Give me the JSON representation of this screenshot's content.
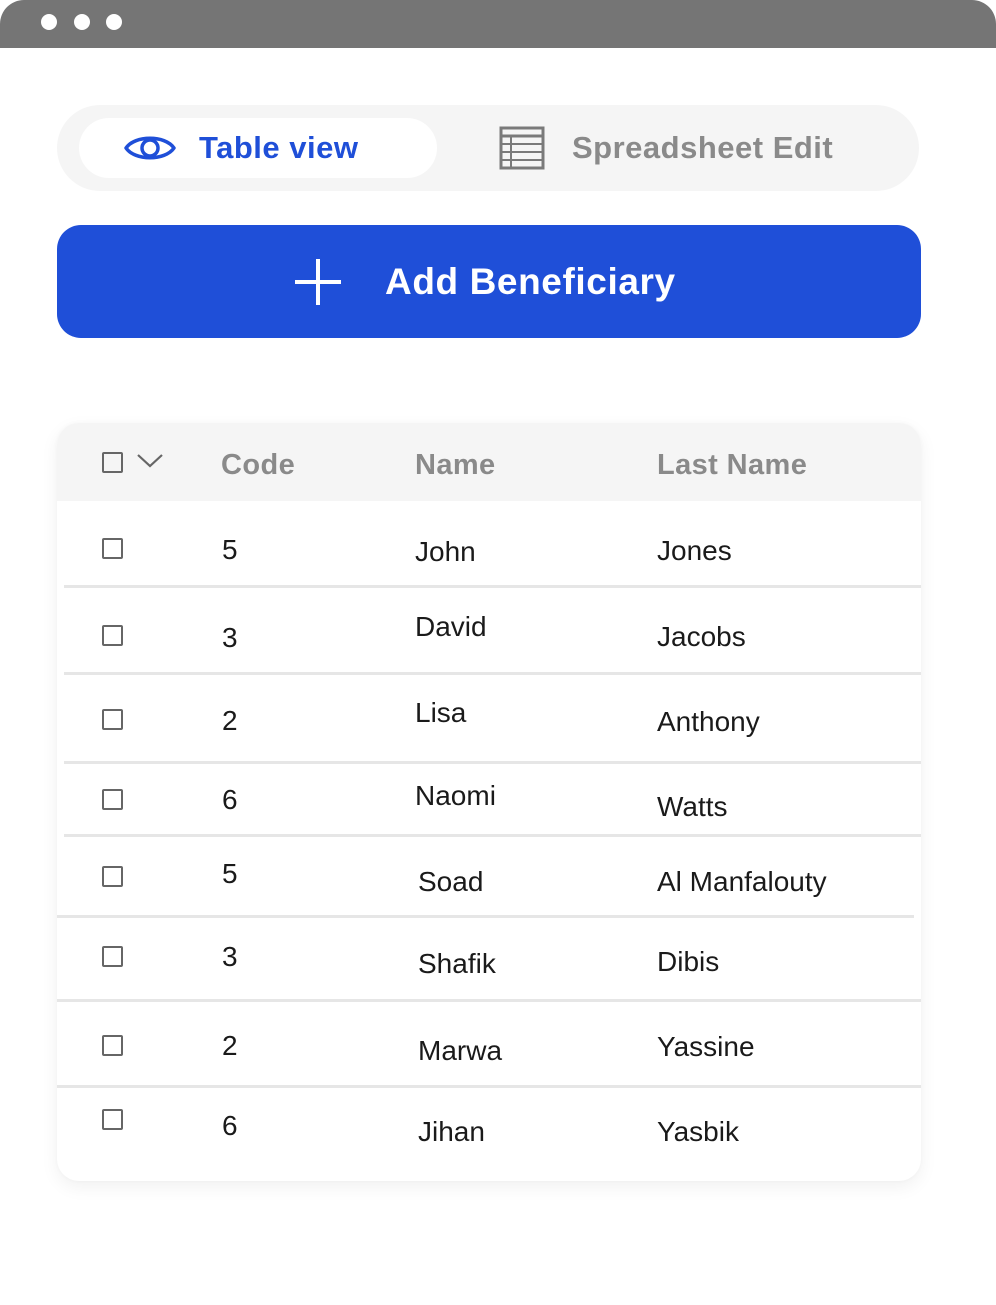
{
  "window": {
    "dots": [
      "close",
      "minimize",
      "maximize"
    ]
  },
  "view_toggle": {
    "active": {
      "label": "Table view",
      "icon": "eye-icon"
    },
    "inactive": {
      "label": "Spreadsheet Edit",
      "icon": "spreadsheet-icon"
    }
  },
  "add_button": {
    "label": "Add Beneficiary",
    "icon": "plus-icon"
  },
  "table": {
    "columns": [
      "Code",
      "Name",
      "Last Name"
    ],
    "rows": [
      {
        "code": "5",
        "name": "John",
        "last_name": "Jones"
      },
      {
        "code": "3",
        "name": "David",
        "last_name": "Jacobs"
      },
      {
        "code": "2",
        "name": "Lisa",
        "last_name": "Anthony"
      },
      {
        "code": "6",
        "name": "Naomi",
        "last_name": "Watts"
      },
      {
        "code": "5",
        "name": "Soad",
        "last_name": "Al Manfalouty"
      },
      {
        "code": "3",
        "name": "Shafik",
        "last_name": "Dibis"
      },
      {
        "code": "2",
        "name": "Marwa",
        "last_name": "Yassine"
      },
      {
        "code": "6",
        "name": "Jihan",
        "last_name": "Yasbik"
      }
    ]
  },
  "colors": {
    "accent": "#1f4fd8",
    "titlebar": "#757575",
    "header_bg": "#f5f5f5",
    "muted_text": "#8a8a8a"
  }
}
